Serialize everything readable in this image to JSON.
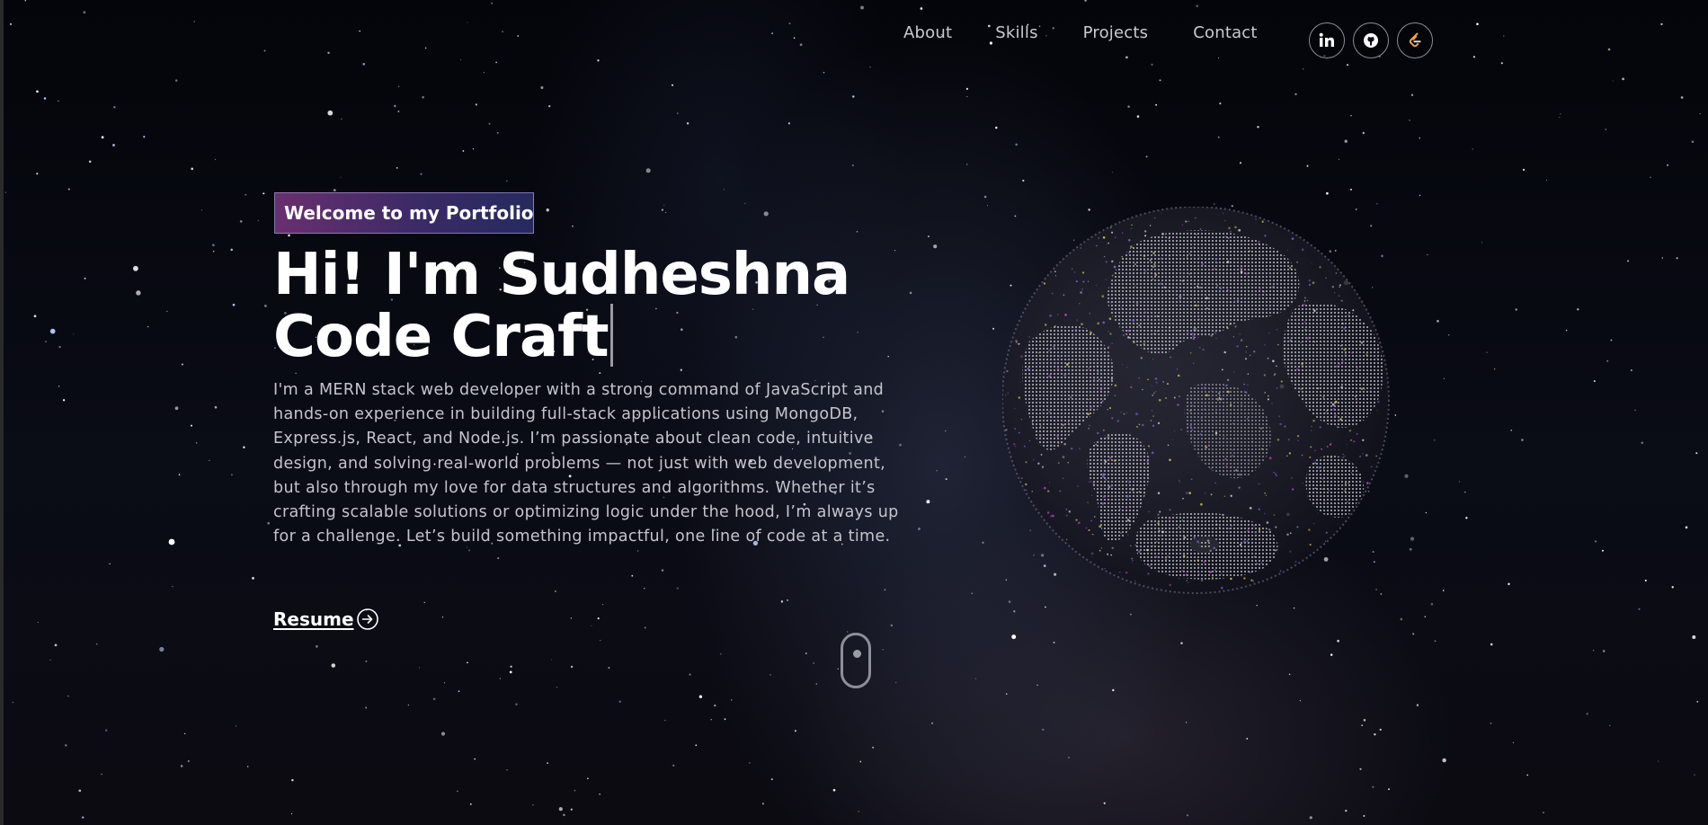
{
  "nav": {
    "links": [
      {
        "label": "About"
      },
      {
        "label": "Skills"
      },
      {
        "label": "Projects"
      },
      {
        "label": "Contact"
      }
    ],
    "socials": [
      {
        "icon": "linkedin-icon"
      },
      {
        "icon": "github-icon"
      },
      {
        "icon": "leetcode-icon"
      }
    ]
  },
  "hero": {
    "tagline": "Welcome to my Portfolio",
    "title_line1": "Hi! I'm Sudheshna",
    "title_line2": "Code Craft",
    "description": "I'm a MERN stack web developer with a strong command of JavaScript and hands-on experience in building full-stack applications using MongoDB, Express.js, React, and Node.js. I’m passionate about clean code, intuitive design, and solving real-world problems — not just with web development, but also through my love for data structures and algorithms. Whether it’s crafting scalable solutions or optimizing logic under the hood, I’m always up for a challenge. Let’s build something impactful, one line of code at a time.",
    "resume_label": "Resume"
  },
  "colors": {
    "background": "#05060b",
    "tagline_gradient_start": "#6a2f6f",
    "tagline_gradient_end": "#252a5f",
    "text_primary": "#ffffff",
    "text_secondary": "#c4c5cc",
    "leetcode_accent": "#f0a23b"
  }
}
